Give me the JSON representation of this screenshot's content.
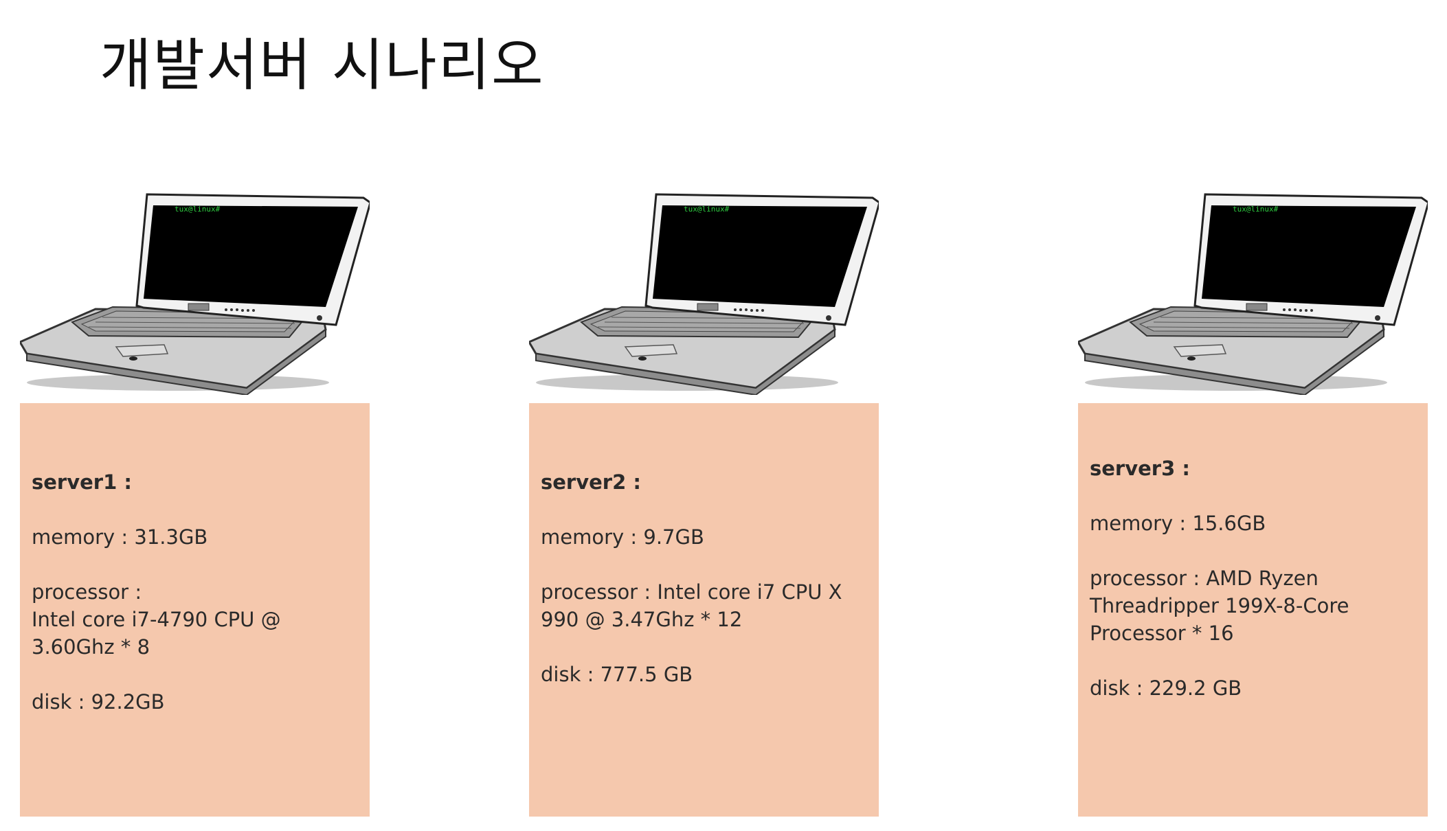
{
  "title": "개발서버 시나리오",
  "laptop_screen_prompt": "tux@linux#",
  "colors": {
    "card_background": "#f5c8ad",
    "screen": "#000000",
    "prompt": "#2ecc40"
  },
  "servers": [
    {
      "name": "server1 :",
      "memory": "memory : 31.3GB",
      "processor_label": "processor :",
      "processor_value": "Intel core i7-4790 CPU @ 3.60Ghz * 8",
      "disk": "disk : 92.2GB"
    },
    {
      "name": "server2 :",
      "memory": "memory : 9.7GB",
      "processor_label": "processor : Intel core i7 CPU X 990 @ 3.47Ghz * 12",
      "processor_value": "",
      "disk": "disk : 777.5 GB"
    },
    {
      "name": "server3 :",
      "memory": "memory : 15.6GB",
      "processor_label": "processor : AMD Ryzen Threadripper 199X-8-Core Processor * 16",
      "processor_value": "",
      "disk": "disk : 229.2 GB"
    }
  ]
}
